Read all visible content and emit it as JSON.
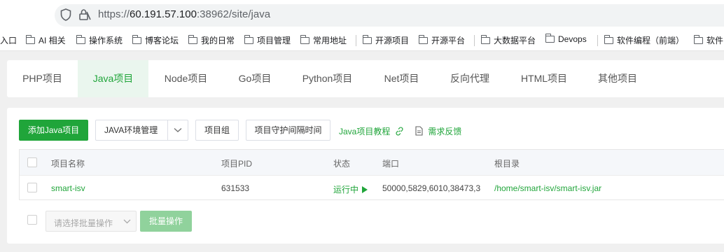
{
  "browser": {
    "url_scheme": "https://",
    "url_host": "60.191.57.100",
    "url_rest": ":38962/site/java"
  },
  "bookmarks": [
    {
      "label": "入口",
      "folder": false
    },
    {
      "label": "AI 相关",
      "folder": true
    },
    {
      "label": "操作系统",
      "folder": true
    },
    {
      "label": "博客论坛",
      "folder": true
    },
    {
      "label": "我的日常",
      "folder": true
    },
    {
      "label": "项目管理",
      "folder": true
    },
    {
      "label": "常用地址",
      "folder": true
    },
    {
      "label": "开源项目",
      "folder": true
    },
    {
      "label": "开源平台",
      "folder": true
    },
    {
      "label": "大数据平台",
      "folder": true
    },
    {
      "label": "Devops",
      "folder": true
    },
    {
      "label": "软件编程（前端）",
      "folder": true
    },
    {
      "label": "软件",
      "folder": true
    }
  ],
  "tabs": [
    {
      "label": "PHP项目"
    },
    {
      "label": "Java项目",
      "active": true
    },
    {
      "label": "Node项目"
    },
    {
      "label": "Go项目"
    },
    {
      "label": "Python项目"
    },
    {
      "label": "Net项目"
    },
    {
      "label": "反向代理"
    },
    {
      "label": "HTML项目"
    },
    {
      "label": "其他项目"
    }
  ],
  "toolbar": {
    "add_label": "添加Java项目",
    "env_label": "JAVA环境管理",
    "group_label": "项目组",
    "interval_label": "项目守护间隔时间",
    "tutorial_label": "Java项目教程",
    "feedback_label": "需求反馈"
  },
  "table": {
    "headers": {
      "name": "项目名称",
      "pid": "项目PID",
      "status": "状态",
      "port": "端口",
      "root": "根目录"
    },
    "rows": [
      {
        "name": "smart-isv",
        "pid": "631533",
        "status": "运行中",
        "port": "50000,5829,6010,38473,3",
        "root": "/home/smart-isv/smart-isv.jar"
      }
    ]
  },
  "batch": {
    "select_placeholder": "请选择批量操作",
    "button_label": "批量操作"
  },
  "colors": {
    "accent": "#20a53a",
    "accent_light": "#eaf6ee",
    "disabled": "#90d29c"
  }
}
